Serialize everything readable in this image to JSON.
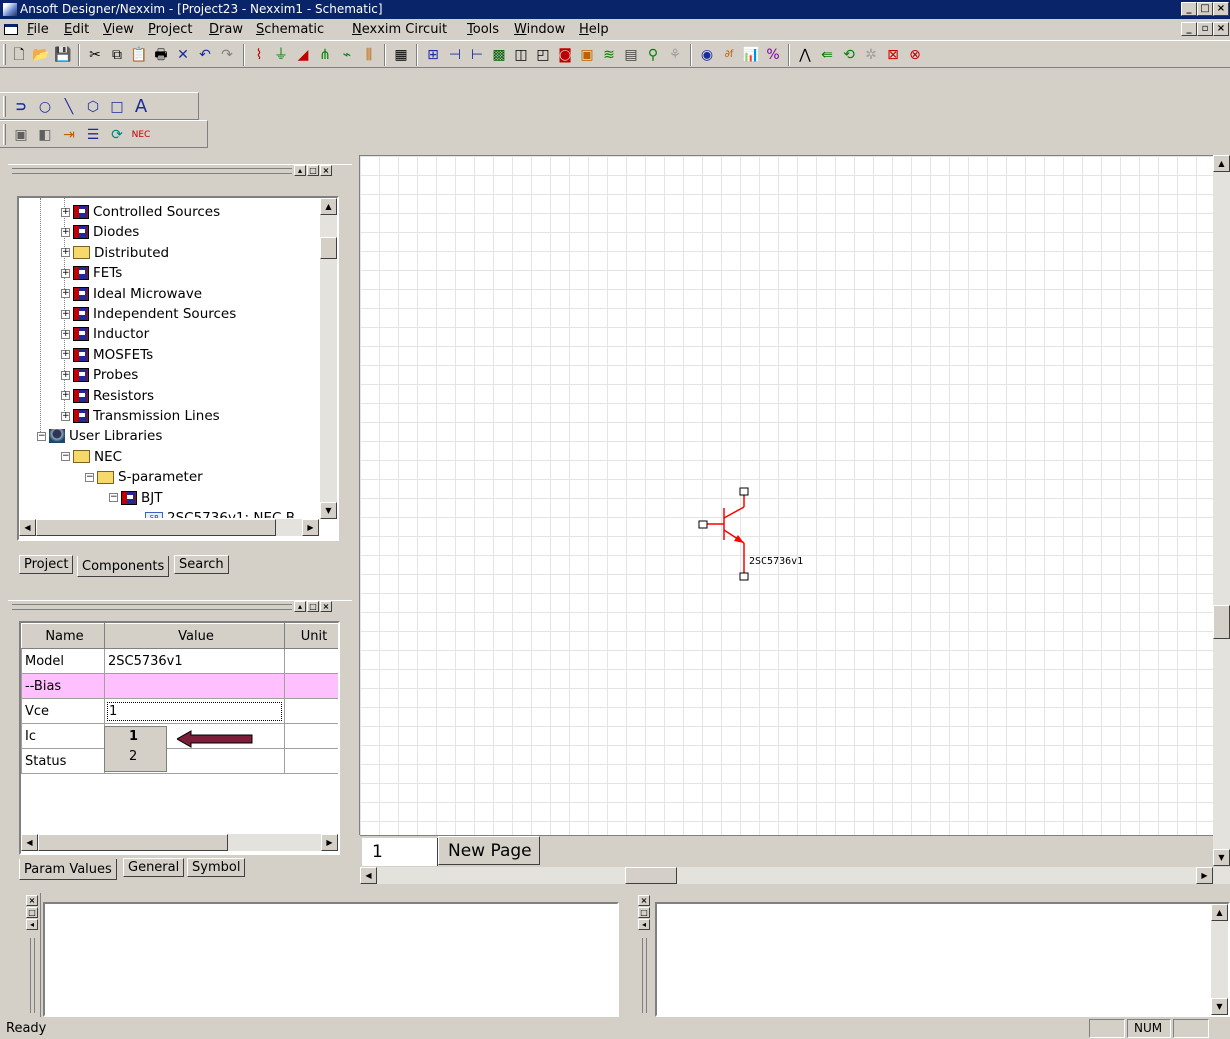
{
  "window": {
    "title": "Ansoft Designer/Nexxim  - [Project23 - Nexxim1 - Schematic]"
  },
  "menu": {
    "items": [
      "File",
      "Edit",
      "View",
      "Project",
      "Draw",
      "Schematic",
      "Nexxim Circuit",
      "Tools",
      "Window",
      "Help"
    ]
  },
  "toolbar": {
    "draw_tools": [
      "arc-tool",
      "circle-tool",
      "line-tool",
      "polygon-tool",
      "rectangle-tool",
      "text-tool"
    ],
    "draw_text_glyph": "A"
  },
  "component_tree": {
    "items": [
      {
        "label": "Controlled Sources",
        "depth": 2,
        "icon": "library-book"
      },
      {
        "label": "Diodes",
        "depth": 2,
        "icon": "library-book"
      },
      {
        "label": "Distributed",
        "depth": 2,
        "icon": "folder"
      },
      {
        "label": "FETs",
        "depth": 2,
        "icon": "library-book"
      },
      {
        "label": "Ideal Microwave",
        "depth": 2,
        "icon": "library-book"
      },
      {
        "label": "Independent Sources",
        "depth": 2,
        "icon": "library-book"
      },
      {
        "label": "Inductor",
        "depth": 2,
        "icon": "library-book"
      },
      {
        "label": "MOSFETs",
        "depth": 2,
        "icon": "library-book"
      },
      {
        "label": "Probes",
        "depth": 2,
        "icon": "library-book"
      },
      {
        "label": "Resistors",
        "depth": 2,
        "icon": "library-book"
      },
      {
        "label": "Transmission Lines",
        "depth": 2,
        "icon": "library-book"
      },
      {
        "label": "User Libraries",
        "depth": 1,
        "icon": "user-library"
      },
      {
        "label": "NEC",
        "depth": 2,
        "icon": "folder-open"
      },
      {
        "label": "S-parameter",
        "depth": 3,
        "icon": "folder-open"
      },
      {
        "label": "BJT",
        "depth": 4,
        "icon": "library-book"
      },
      {
        "label": "2SC5736v1: NEC B",
        "depth": 5,
        "icon": "component"
      }
    ]
  },
  "project_tabs": [
    "Project",
    "Components",
    "Search"
  ],
  "project_active_tab": "Components",
  "properties": {
    "headers": {
      "name": "Name",
      "value": "Value",
      "unit": "Unit"
    },
    "rows": [
      {
        "name": "Model",
        "value": "2SC5736v1",
        "unit": ""
      },
      {
        "name": "--Bias",
        "value": "",
        "unit": ""
      },
      {
        "name": "Vce",
        "value": "1",
        "unit": ""
      },
      {
        "name": "Ic",
        "value": "",
        "unit": ""
      },
      {
        "name": "Status",
        "value": "",
        "unit": ""
      }
    ],
    "dropdown_options": [
      "1",
      "2"
    ],
    "dropdown_selected": "1"
  },
  "properties_tabs": [
    "Param Values",
    "General",
    "Symbol"
  ],
  "properties_active_tab": "Param Values",
  "schematic": {
    "component_label": "2SC5736v1",
    "page_tabs": [
      "1",
      "New Page"
    ]
  },
  "colors": {
    "transistor": "#ff0000",
    "bias_row": "#ffc0ff",
    "annotation_arrow": "#7a1e3a"
  },
  "status": {
    "text": "Ready",
    "num": "NUM"
  }
}
